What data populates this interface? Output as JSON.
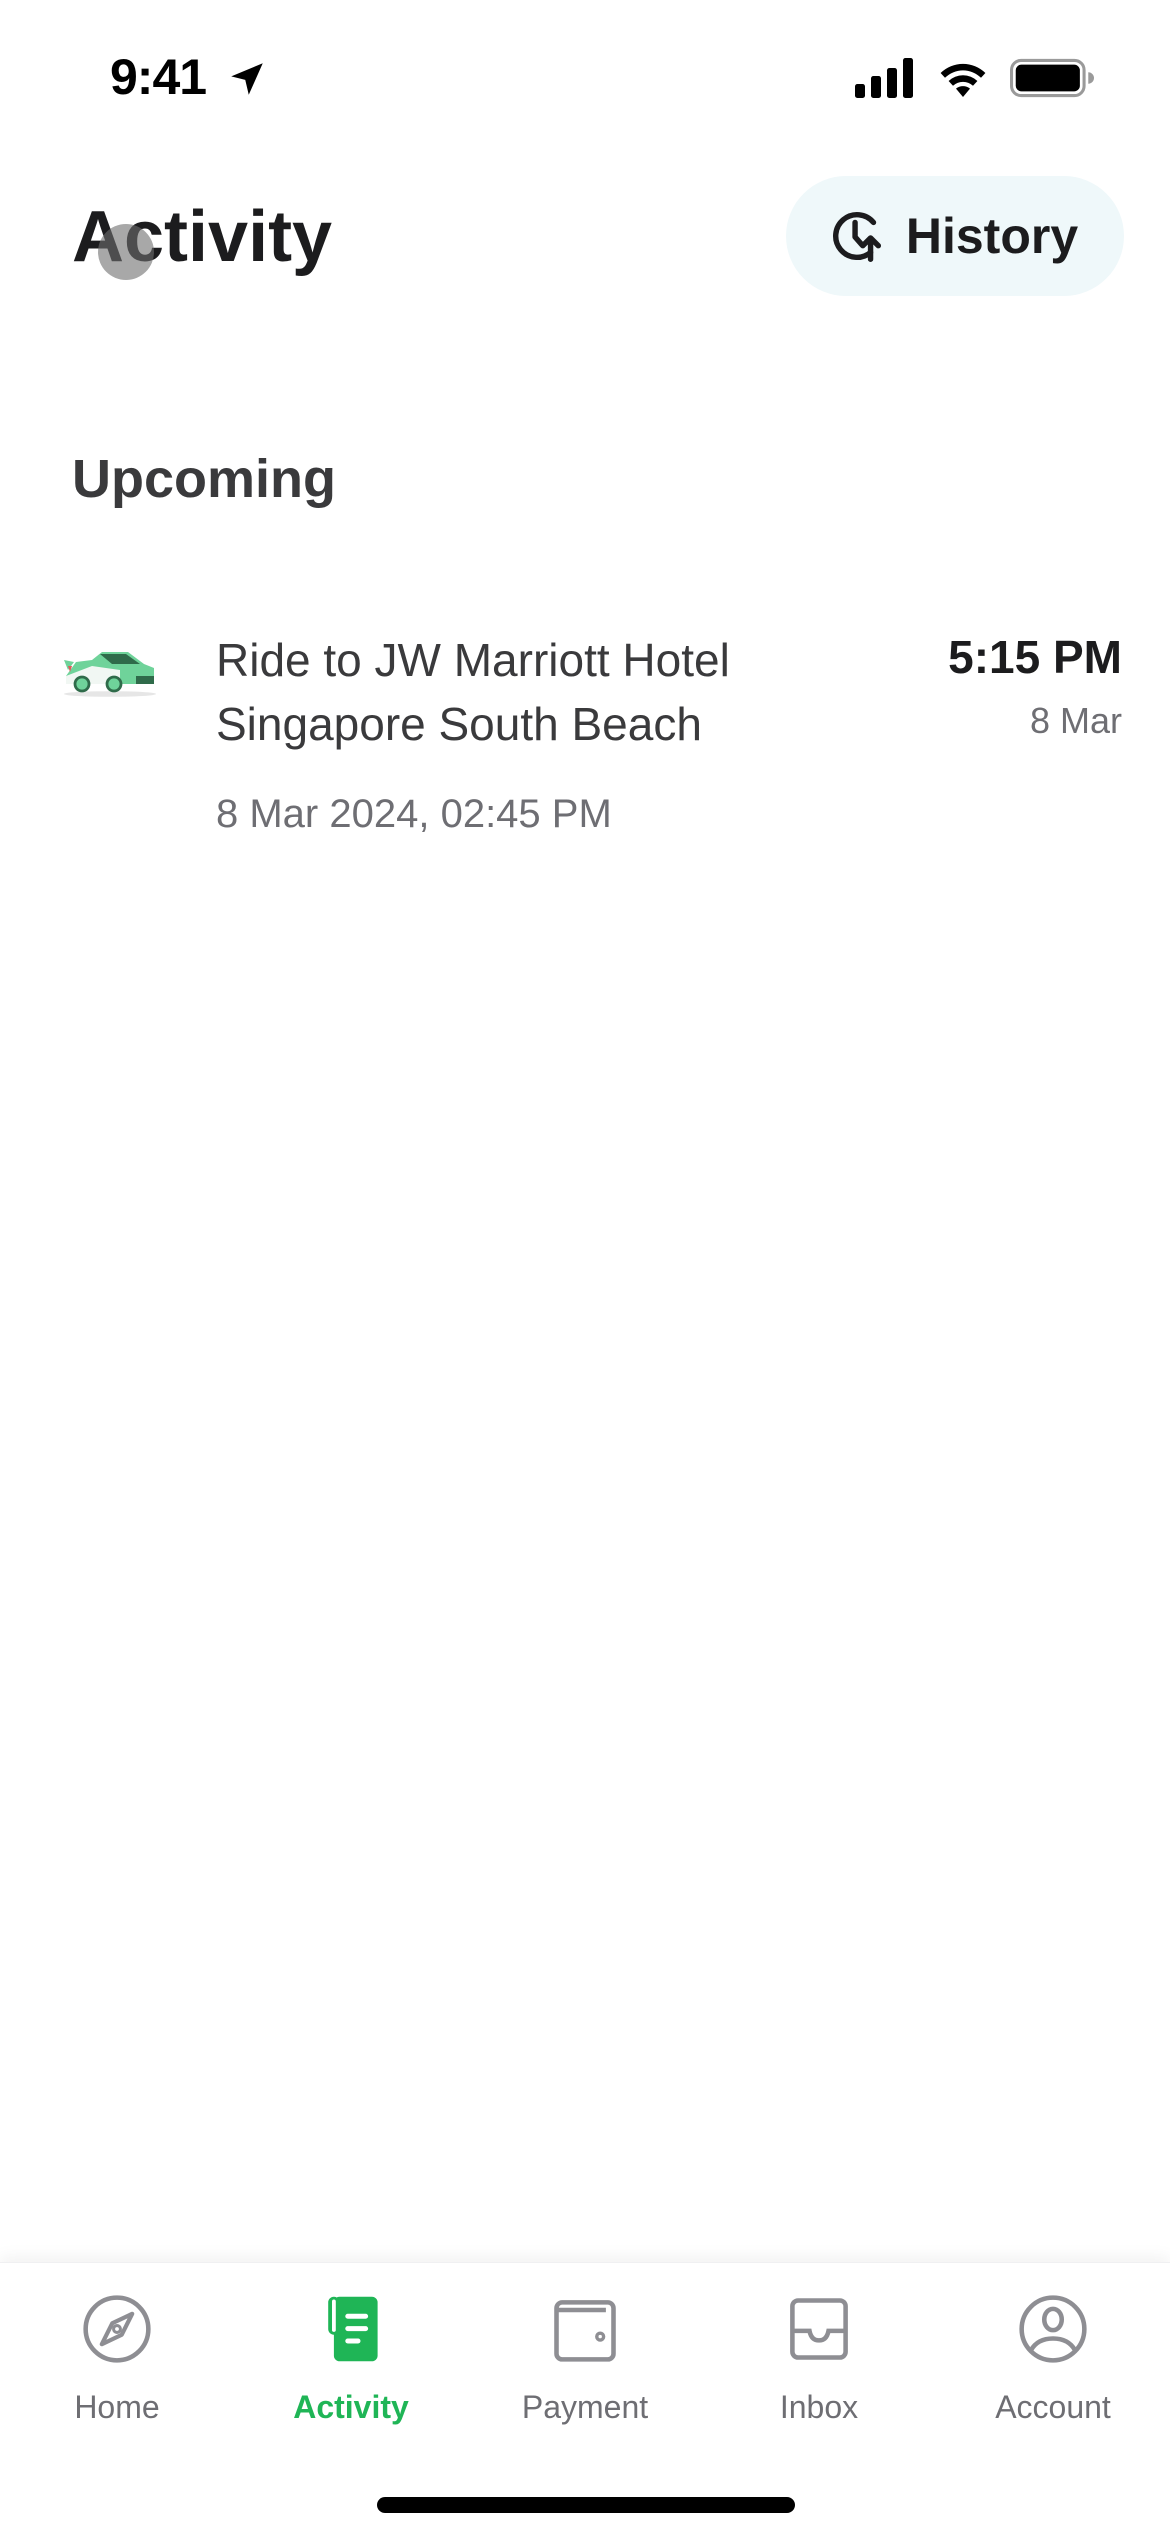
{
  "status_bar": {
    "time": "9:41",
    "icons": [
      "location-arrow-icon",
      "cellular-signal-icon",
      "wifi-icon",
      "battery-icon"
    ]
  },
  "header": {
    "title": "Activity",
    "history_button": {
      "label": "History",
      "icon": "clock-history-icon"
    }
  },
  "upcoming": {
    "section_title": "Upcoming",
    "items": [
      {
        "icon": "car-icon",
        "title": "Ride to JW Marriott Hotel Singapore South Beach",
        "datetime": "8 Mar 2024, 02:45 PM",
        "time": "5:15 PM",
        "date": "8 Mar"
      }
    ]
  },
  "tab_bar": {
    "active": "Activity",
    "accent_color": "#1fb556",
    "inactive_color": "#8e8e93",
    "tabs": [
      {
        "label": "Home",
        "icon": "compass-icon"
      },
      {
        "label": "Activity",
        "icon": "receipt-icon"
      },
      {
        "label": "Payment",
        "icon": "wallet-icon"
      },
      {
        "label": "Inbox",
        "icon": "inbox-icon"
      },
      {
        "label": "Account",
        "icon": "account-icon"
      }
    ]
  },
  "colors": {
    "history_button_bg": "#eff8fa",
    "title_text": "#1c1c1e",
    "secondary_text": "#6e6e73"
  }
}
